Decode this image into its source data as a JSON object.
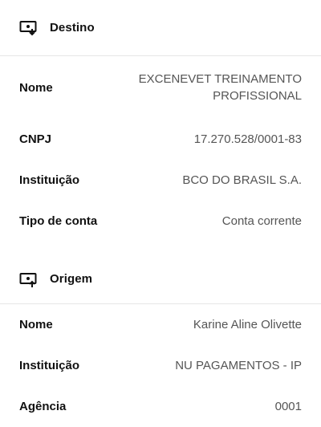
{
  "destino": {
    "title": "Destino",
    "icon": "screen-download-icon",
    "rows": [
      {
        "label": "Nome",
        "value_line1": "EXCENEVET TREINAMENTO",
        "value_line2": "PROFISSIONAL"
      },
      {
        "label": "CNPJ",
        "value": "17.270.528/0001-83"
      },
      {
        "label": "Instituição",
        "value": "BCO DO BRASIL S.A."
      },
      {
        "label": "Tipo de conta",
        "value": "Conta corrente"
      }
    ]
  },
  "origem": {
    "title": "Origem",
    "icon": "screen-upload-icon",
    "rows": [
      {
        "label": "Nome",
        "value": "Karine Aline Olivette"
      },
      {
        "label": "Instituição",
        "value": "NU PAGAMENTOS - IP"
      },
      {
        "label": "Agência",
        "value": "0001"
      }
    ]
  }
}
